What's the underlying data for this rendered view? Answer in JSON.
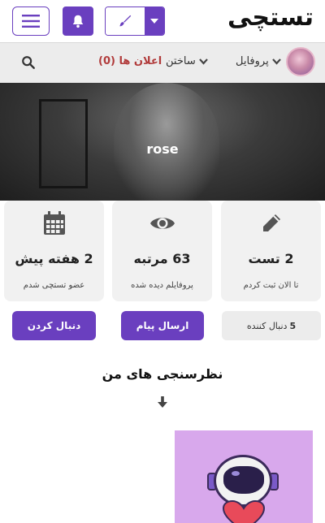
{
  "header": {
    "logo": "تستچی",
    "menu_icon": "hamburger-icon",
    "bell_icon": "bell-icon",
    "create_icon": "brush-icon",
    "dropdown_icon": "caret-down-icon",
    "accent_color": "#6a3fbf"
  },
  "nav": {
    "announcements": "اعلان ها (0)",
    "create": "ساختن",
    "profile": "پروفایل",
    "search_icon": "search-icon"
  },
  "profile": {
    "username": "rose"
  },
  "stats": [
    {
      "value": "2 تست",
      "caption": "تا الان ثبت کردم",
      "icon": "pencil-icon"
    },
    {
      "value": "63 مرتبه",
      "caption": "پروفایلم دیده شده",
      "icon": "eye-icon"
    },
    {
      "value": "2 هفته پیش",
      "caption": "عضو تستچی شدم",
      "icon": "calendar-icon"
    }
  ],
  "actions": {
    "follow": "دنبال کردن",
    "message": "ارسال پیام",
    "followers_count": "5",
    "followers_label": "دنبال کننده"
  },
  "section": {
    "title": "نظرسنجی های من"
  }
}
